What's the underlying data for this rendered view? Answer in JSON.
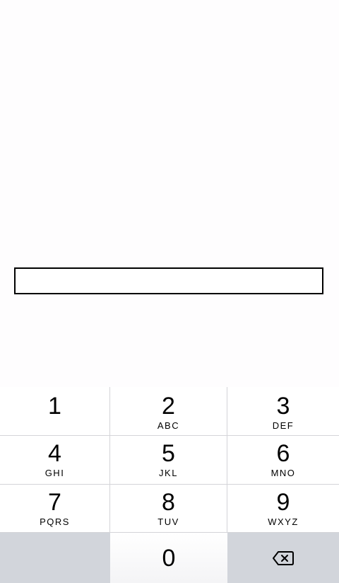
{
  "input": {
    "value": "",
    "placeholder": ""
  },
  "keypad": {
    "keys": [
      {
        "digit": "1",
        "letters": ""
      },
      {
        "digit": "2",
        "letters": "ABC"
      },
      {
        "digit": "3",
        "letters": "DEF"
      },
      {
        "digit": "4",
        "letters": "GHI"
      },
      {
        "digit": "5",
        "letters": "JKL"
      },
      {
        "digit": "6",
        "letters": "MNO"
      },
      {
        "digit": "7",
        "letters": "PQRS"
      },
      {
        "digit": "8",
        "letters": "TUV"
      },
      {
        "digit": "9",
        "letters": "WXYZ"
      },
      {
        "digit": "0",
        "letters": ""
      }
    ],
    "backspace_icon": "backspace-icon"
  },
  "colors": {
    "background": "#fefdfe",
    "input_border": "#000000",
    "key_face": "#ffffff",
    "special_key": "#d2d5db",
    "divider": "#d4d4d8"
  }
}
